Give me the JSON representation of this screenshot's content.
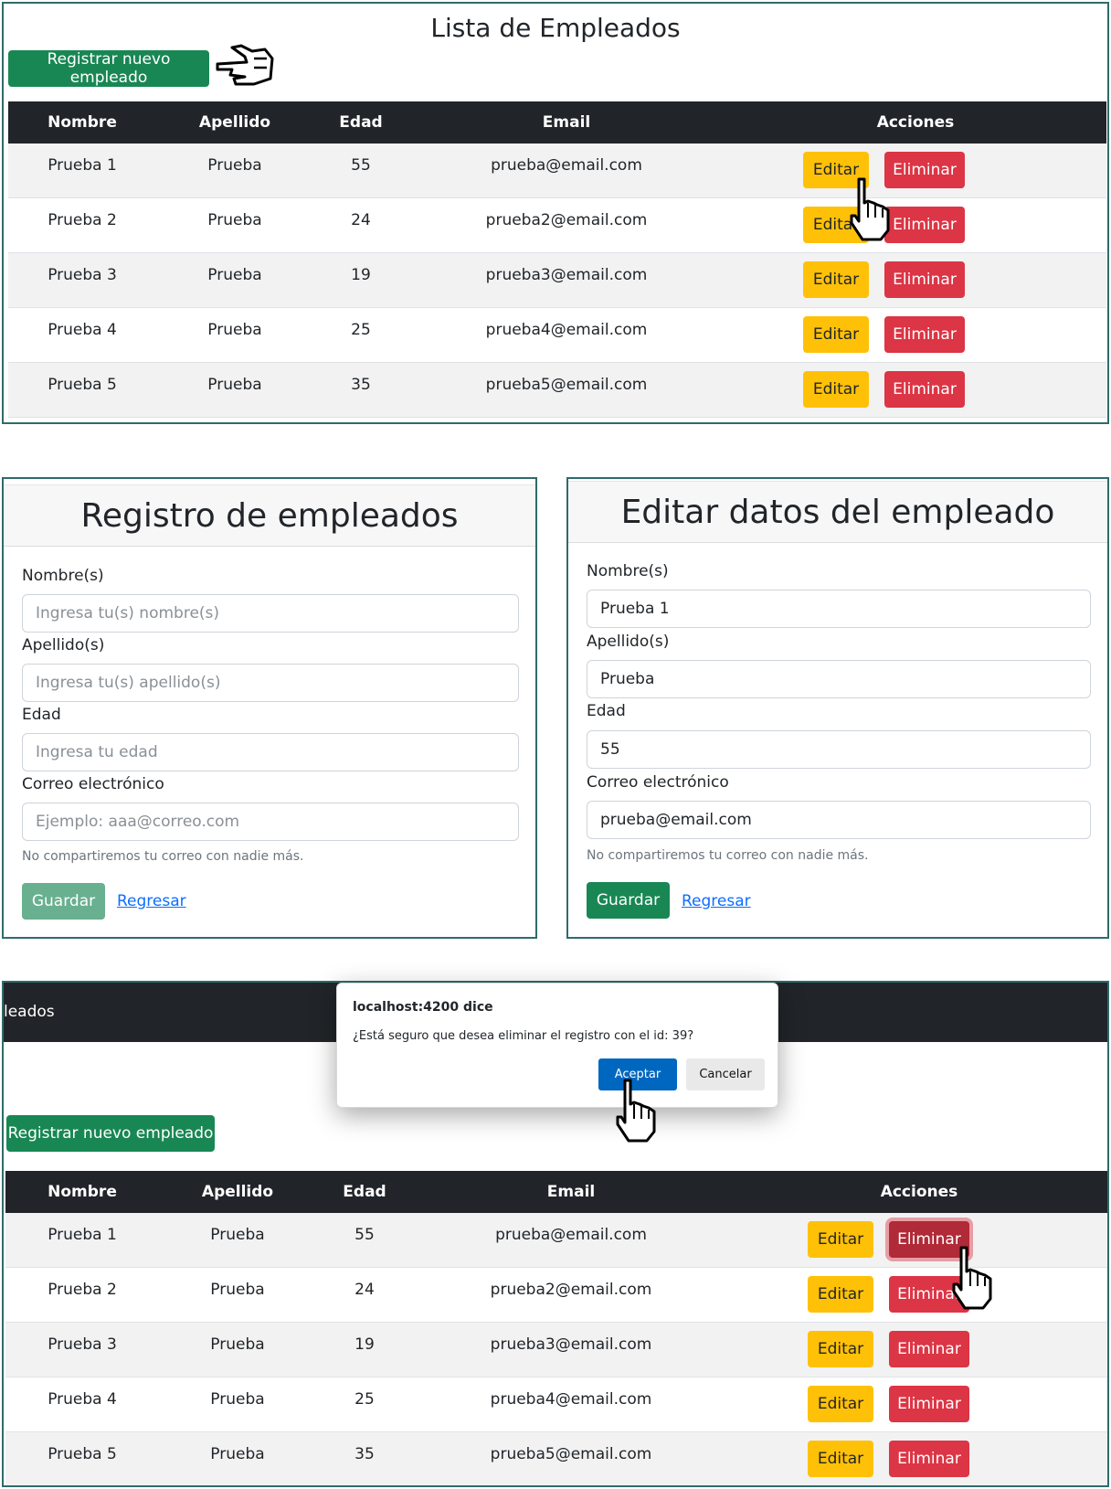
{
  "list": {
    "title": "Lista de Empleados",
    "new_button": "Registrar nuevo empleado",
    "columns": [
      "Nombre",
      "Apellido",
      "Edad",
      "Email",
      "Acciones"
    ],
    "edit_label": "Editar",
    "delete_label": "Eliminar",
    "rows": [
      {
        "nombre": "Prueba 1",
        "apellido": "Prueba",
        "edad": "55",
        "email": "prueba@email.com"
      },
      {
        "nombre": "Prueba 2",
        "apellido": "Prueba",
        "edad": "24",
        "email": "prueba2@email.com"
      },
      {
        "nombre": "Prueba 3",
        "apellido": "Prueba",
        "edad": "19",
        "email": "prueba3@email.com"
      },
      {
        "nombre": "Prueba 4",
        "apellido": "Prueba",
        "edad": "25",
        "email": "prueba4@email.com"
      },
      {
        "nombre": "Prueba 5",
        "apellido": "Prueba",
        "edad": "35",
        "email": "prueba5@email.com"
      }
    ]
  },
  "register_form": {
    "title": "Registro de empleados",
    "name_label": "Nombre(s)",
    "name_placeholder": "Ingresa tu(s) nombre(s)",
    "lastname_label": "Apellido(s)",
    "lastname_placeholder": "Ingresa tu(s) apellido(s)",
    "age_label": "Edad",
    "age_placeholder": "Ingresa tu edad",
    "email_label": "Correo electrónico",
    "email_placeholder": "Ejemplo: aaa@correo.com",
    "email_help": "No compartiremos tu correo con nadie más.",
    "save_button": "Guardar",
    "back_link": "Regresar"
  },
  "edit_form": {
    "title": "Editar datos del empleado",
    "name_label": "Nombre(s)",
    "name_value": "Prueba 1",
    "lastname_label": "Apellido(s)",
    "lastname_value": "Prueba",
    "age_label": "Edad",
    "age_value": "55",
    "email_label": "Correo electrónico",
    "email_value": "prueba@email.com",
    "email_help": "No compartiremos tu correo con nadie más.",
    "save_button": "Guardar",
    "back_link": "Regresar"
  },
  "delete_view": {
    "navbar_brand": "leados",
    "new_button": "Registrar nuevo empleado",
    "dialog": {
      "title": "localhost:4200 dice",
      "message": "¿Está seguro que desea eliminar el registro con el id: 39?",
      "ok": "Aceptar",
      "cancel": "Cancelar"
    }
  },
  "colors": {
    "primary_green": "#198754",
    "warning_yellow": "#ffc107",
    "danger_red": "#dc3545",
    "dark_header": "#212529",
    "panel_border": "#2f6b6b"
  }
}
